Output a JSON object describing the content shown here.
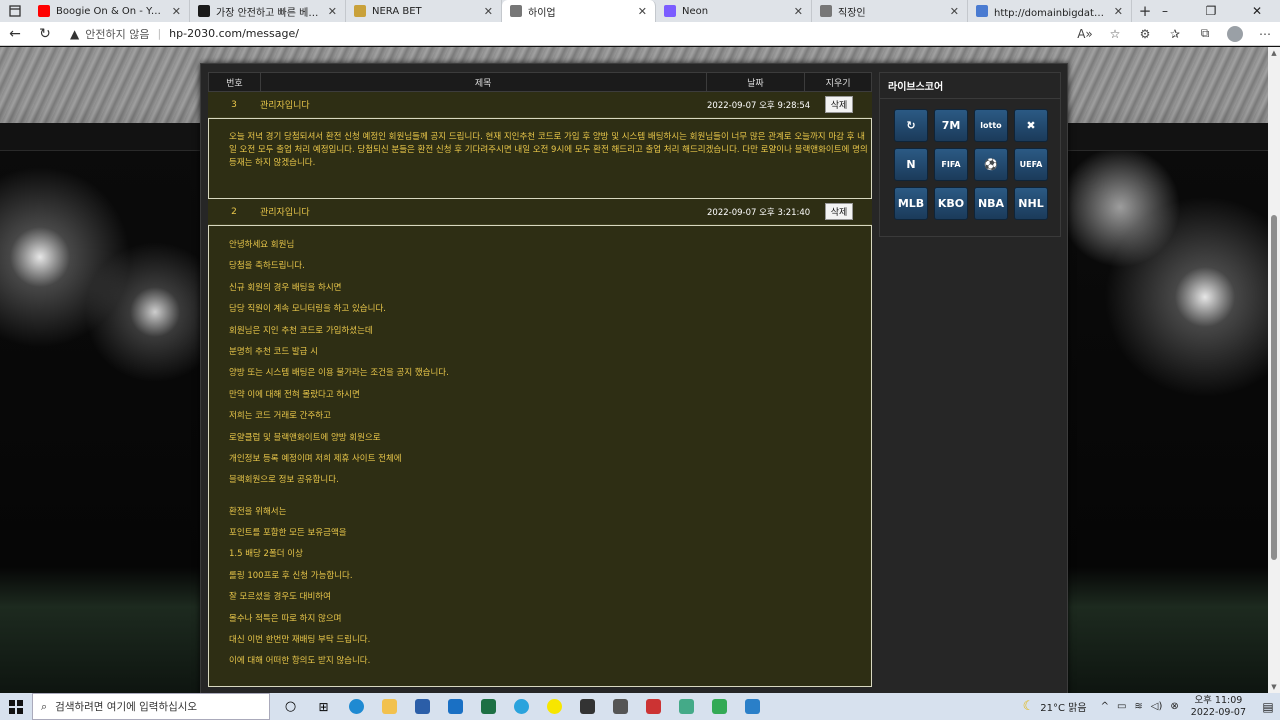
{
  "browser": {
    "tabs": [
      {
        "label": "Boogie On & On - YouTube",
        "icon": "youtube-icon",
        "color": "#ff0000"
      },
      {
        "label": "가장 안전하고 빠른 베팅 | WBC",
        "icon": "wbc-icon",
        "color": "#1a1a1a"
      },
      {
        "label": "NERA BET",
        "icon": "nerabet-icon",
        "color": "#c9a13a"
      },
      {
        "label": "하이업",
        "icon": "page-icon",
        "color": "#777777"
      },
      {
        "label": "Neon",
        "icon": "neon-icon",
        "color": "#7b5cff"
      },
      {
        "label": "직장인",
        "icon": "page-icon",
        "color": "#777777"
      },
      {
        "label": "http://domainbigdata.com - 김",
        "icon": "search-icon",
        "color": "#4a7bd1"
      }
    ],
    "active_tab": 3,
    "insecure_label": "안전하지 않음",
    "url": "hp-2030.com/message/"
  },
  "board": {
    "headers": {
      "num": "번호",
      "title": "제목",
      "date": "날짜",
      "delete": "지우기"
    },
    "messages": [
      {
        "num": "3",
        "title": "관리자입니다",
        "date": "2022-09-07 오후 9:28:54",
        "delete_label": "삭제",
        "body": "오늘 저녁 경기 당첨되셔서 환전 신청 예정인 회원님들께 공지 드립니다. 현재 지인추천 코드로 가입 후 양방 및 시스템 배팅하시는 회원님들이 너무 많은 관계로 오늘까지 마감 후 내일 오전 모두 출업 처리 예정입니다. 당첨되신 분들은 환전 신청 후 기다려주시면 내일 오전 9시에 모두 환전 해드리고 출업 처리 해드리겠습니다. 다만 로얄이나 블랙앤화이트에 명의 등재는 하지 않겠습니다."
      },
      {
        "num": "2",
        "title": "관리자입니다",
        "date": "2022-09-07 오후 3:21:40",
        "delete_label": "삭제",
        "lines": [
          "안녕하세요 회원님",
          "당첨을 축하드립니다.",
          "신규 회원의 경우 배팅을 하시면",
          "담당 직원이 계속 모니터링을 하고 있습니다.",
          "회원님은 지인 추천 코드로 가입하셨는데",
          "분명히 추천 코드 발급 시",
          "양방 또는 시스템 배팅은 이용 불가라는 조건을 공지 했습니다.",
          "만약 이에 대해 전혀 몰랐다고 하시면",
          "저희는 코드 거래로 간주하고",
          "로얄클럽 및 블랙앤화이트에 양방 회원으로",
          "개인정보 등록 예정이며 저희 제휴 사이트 전체에",
          "블랙회원으로 정보 공유합니다.",
          "",
          "환전을 위해서는",
          "포인트를 포함한 모든 보유금액을",
          "1.5 배당 2폴더 이상",
          "롤링 100프로 후 신청 가능합니다.",
          "잘 모르셨을 경우도 대비하여",
          "몰수나 적특은 따로 하지 않으며",
          "대신 이번 한번만 재배팅 부탁 드립니다.",
          "이에 대해 어떠한 항의도 받지 않습니다."
        ]
      }
    ]
  },
  "live_score": {
    "title": "라이브스코어",
    "items": [
      {
        "name": "livescore-refresh-icon",
        "text": "↻"
      },
      {
        "name": "7m-icon",
        "text": "7M"
      },
      {
        "name": "lotto-icon",
        "text": "lotto"
      },
      {
        "name": "crossed-balls-icon",
        "text": "✖"
      },
      {
        "name": "naver-icon",
        "text": "N"
      },
      {
        "name": "fifa-icon",
        "text": "FIFA"
      },
      {
        "name": "champions-league-icon",
        "text": "⚽"
      },
      {
        "name": "uefa-icon",
        "text": "UEFA"
      },
      {
        "name": "mlb-icon",
        "text": "MLB"
      },
      {
        "name": "kbo-icon",
        "text": "KBO"
      },
      {
        "name": "nba-icon",
        "text": "NBA"
      },
      {
        "name": "nhl-icon",
        "text": "NHL"
      }
    ]
  },
  "taskbar": {
    "search_placeholder": "검색하려면 여기에 입력하십시오",
    "weather": "21°C 맑음",
    "time": "오후 11:09",
    "date": "2022-09-07"
  },
  "colors": {
    "accent_text": "#e8c64a",
    "row_bg": "#2e2e14",
    "panel_bg": "#252525"
  }
}
